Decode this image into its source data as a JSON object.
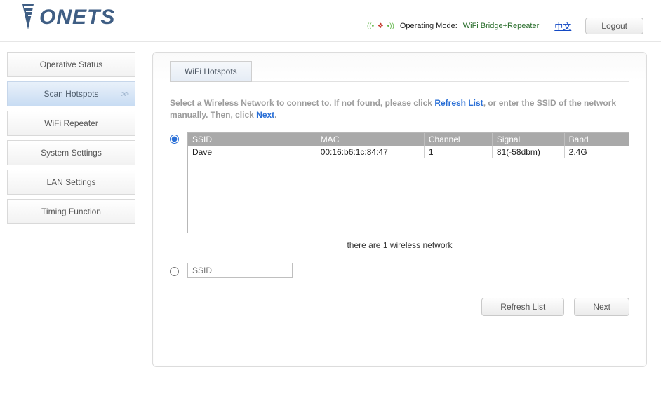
{
  "brand": "VONETS",
  "top": {
    "mode_label": "Operating Mode:",
    "mode_value": "WiFi Bridge+Repeater",
    "lang": "中文",
    "logout": "Logout"
  },
  "sidebar": {
    "items": [
      {
        "label": "Operative Status"
      },
      {
        "label": "Scan Hotspots",
        "active": true
      },
      {
        "label": "WiFi Repeater"
      },
      {
        "label": "System Settings"
      },
      {
        "label": "LAN Settings"
      },
      {
        "label": "Timing Function"
      }
    ]
  },
  "tab": "WiFi Hotspots",
  "instruction": {
    "p1": "Select a Wireless Network to connect to. If not found, please click ",
    "hl1": "Refresh List",
    "p2": ", or enter the SSID of the network manually. Then, click ",
    "hl2": "Next",
    "p3": "."
  },
  "columns": {
    "ssid": "SSID",
    "mac": "MAC",
    "channel": "Channel",
    "signal": "Signal",
    "band": "Band"
  },
  "networks": [
    {
      "ssid": "Dave",
      "mac": "00:16:b6:1c:84:47",
      "channel": "1",
      "signal": "81(-58dbm)",
      "band": "2.4G"
    }
  ],
  "count_text": "there are 1 wireless network",
  "manual_placeholder": "SSID",
  "buttons": {
    "refresh": "Refresh List",
    "next": "Next"
  }
}
